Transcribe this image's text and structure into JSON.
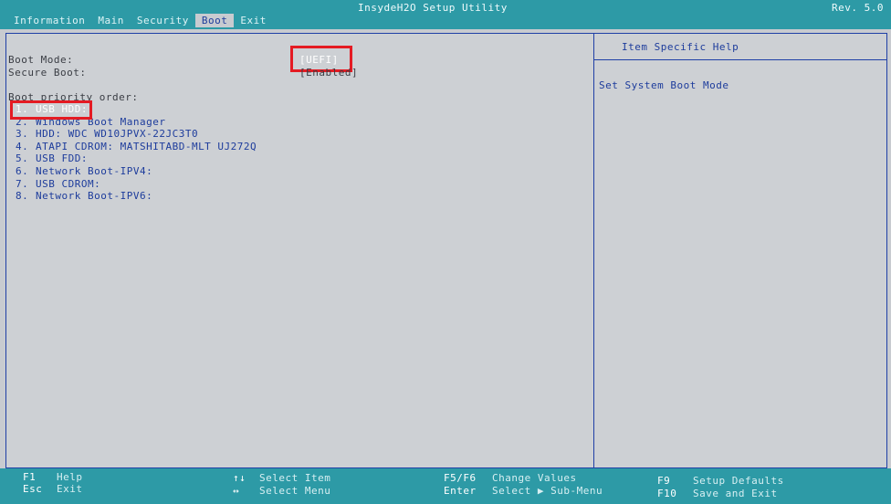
{
  "app": {
    "title": "InsydeH2O Setup Utility",
    "revision": "Rev. 5.0"
  },
  "menu": {
    "tabs": [
      {
        "label": "Information"
      },
      {
        "label": "Main"
      },
      {
        "label": "Security"
      },
      {
        "label": "Boot"
      },
      {
        "label": "Exit"
      }
    ],
    "active": "Boot"
  },
  "settings": {
    "boot_mode": {
      "label": "Boot Mode:",
      "value": "[UEFI]"
    },
    "secure_boot": {
      "label": "Secure Boot:",
      "value": "[Enabled]"
    },
    "priority_heading": "Boot priority order:"
  },
  "boot_order": [
    {
      "num": "1.",
      "name": "USB HDD:"
    },
    {
      "num": "2.",
      "name": "Windows Boot Manager"
    },
    {
      "num": "3.",
      "name": "HDD: WDC WD10JPVX-22JC3T0"
    },
    {
      "num": "4.",
      "name": "ATAPI CDROM: MATSHITABD-MLT UJ272Q"
    },
    {
      "num": "5.",
      "name": "USB FDD:"
    },
    {
      "num": "6.",
      "name": "Network Boot-IPV4:"
    },
    {
      "num": "7.",
      "name": "USB CDROM:"
    },
    {
      "num": "8.",
      "name": "Network Boot-IPV6:"
    }
  ],
  "help_panel": {
    "title": "Item Specific Help",
    "text": "Set System Boot Mode"
  },
  "footer": {
    "f1": {
      "key": "F1",
      "desc": "Help"
    },
    "esc": {
      "key": "Esc",
      "desc": "Exit"
    },
    "select_item": {
      "key": "↑↓",
      "desc": "Select Item"
    },
    "select_menu": {
      "key": "↔",
      "desc": "Select Menu"
    },
    "change_values": {
      "key": "F5/F6",
      "desc": "Change Values"
    },
    "enter": {
      "key": "Enter",
      "desc": "Select ▶ Sub-Menu"
    },
    "f9": {
      "key": "F9",
      "desc": "Setup Defaults"
    },
    "f10": {
      "key": "F10",
      "desc": "Save and Exit"
    }
  },
  "colors": {
    "bar": "#2d9aa6",
    "panel": "#cdd0d4",
    "accent_text": "#1d3c9c",
    "border": "#1f3fa6",
    "highlight": "#e41b23"
  }
}
